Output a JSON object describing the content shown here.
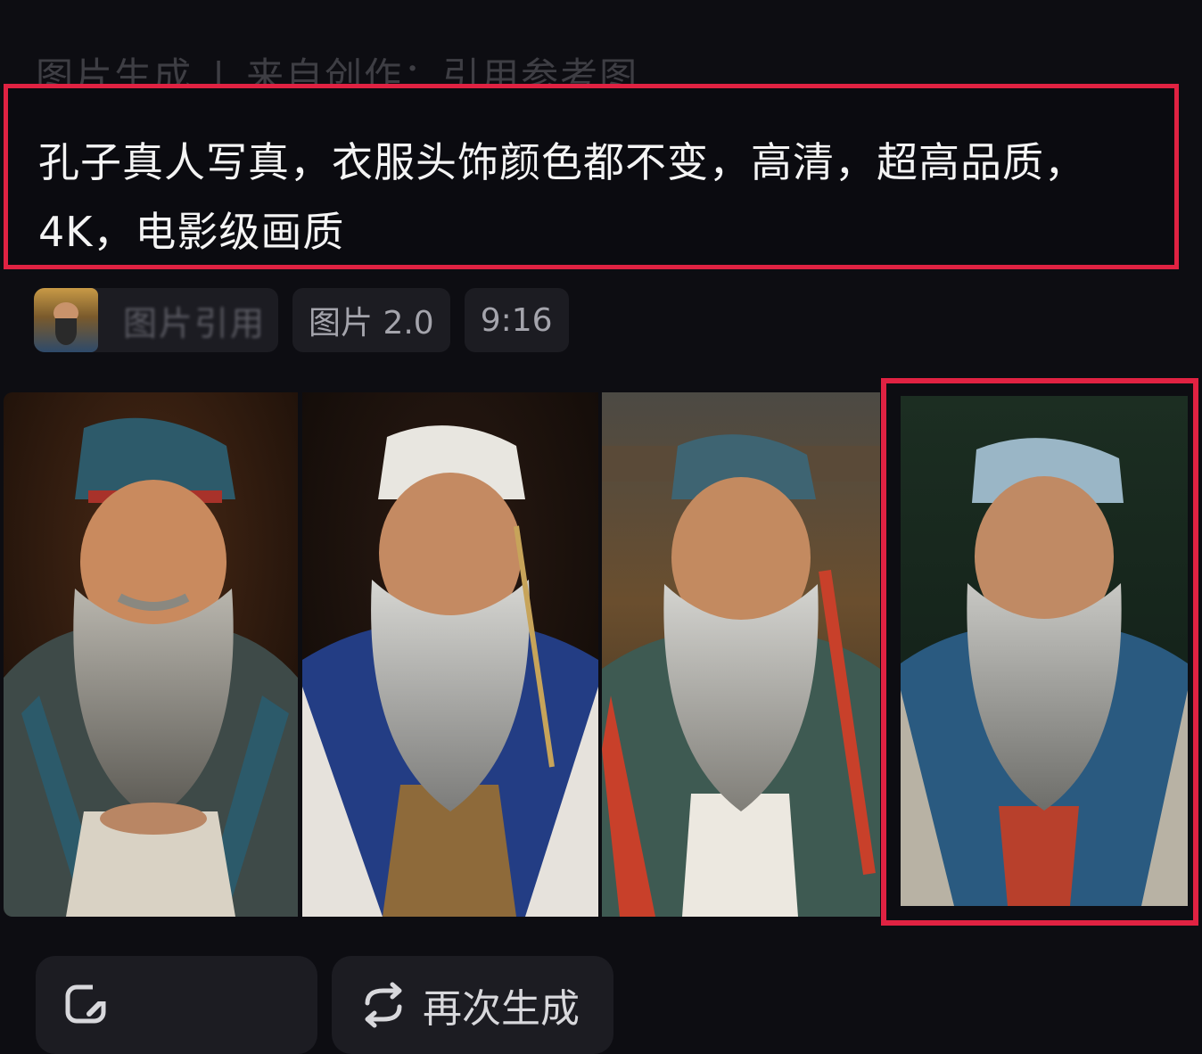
{
  "breadcrumb": {
    "section": "图片生成",
    "separator": "|",
    "source": "来自创作：引用参考图"
  },
  "prompt": {
    "text": "孔子真人写真，衣服头饰颜色都不变，高清，超高品质，4K，电影级画质"
  },
  "meta": {
    "reference_label": "图片引用",
    "model": "图片 2.0",
    "ratio": "9:16"
  },
  "images": [
    {
      "alt": "portrait-1"
    },
    {
      "alt": "portrait-2"
    },
    {
      "alt": "portrait-3"
    },
    {
      "alt": "portrait-4",
      "selected": true
    }
  ],
  "actions": {
    "edit_label": "",
    "regenerate_label": "再次生成"
  },
  "colors": {
    "background": "#0d0d12",
    "highlight": "#e02242",
    "chip": "#1c1c22"
  }
}
